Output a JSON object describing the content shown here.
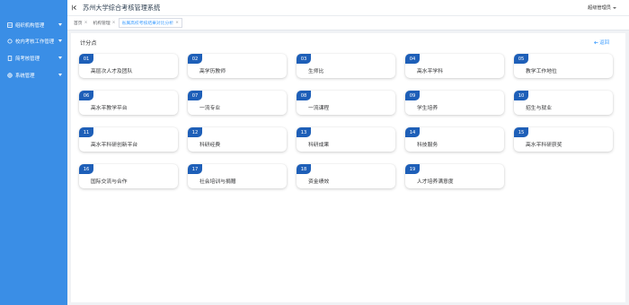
{
  "app": {
    "title": "苏州大学综合考核管理系统"
  },
  "header": {
    "user_label": "超级管理员"
  },
  "sidebar": {
    "items": [
      {
        "label": "组织机构管理",
        "icon": "org-icon"
      },
      {
        "label": "校内考核工作管理",
        "icon": "work-icon"
      },
      {
        "label": "简考核管理",
        "icon": "eval-icon"
      },
      {
        "label": "系统管理",
        "icon": "settings-icon"
      }
    ]
  },
  "tabs": [
    {
      "label": "首页",
      "active": false
    },
    {
      "label": "机构管理",
      "active": false
    },
    {
      "label": "省属高校考核结果对比分析",
      "active": true
    }
  ],
  "main": {
    "section_title": "计分点",
    "back_label": "返回",
    "cards": [
      {
        "num": "01",
        "label": "高层次人才及团队"
      },
      {
        "num": "02",
        "label": "高学历教师"
      },
      {
        "num": "03",
        "label": "生师比"
      },
      {
        "num": "04",
        "label": "高水平学科"
      },
      {
        "num": "05",
        "label": "教学工作地位"
      },
      {
        "num": "06",
        "label": "高水平教学平台"
      },
      {
        "num": "07",
        "label": "一流专业"
      },
      {
        "num": "08",
        "label": "一流课程"
      },
      {
        "num": "09",
        "label": "学生培养"
      },
      {
        "num": "10",
        "label": "招生与就业"
      },
      {
        "num": "11",
        "label": "高水平科研创新平台"
      },
      {
        "num": "12",
        "label": "科研经费"
      },
      {
        "num": "13",
        "label": "科研成果"
      },
      {
        "num": "14",
        "label": "科技服务"
      },
      {
        "num": "15",
        "label": "高水平科研获奖"
      },
      {
        "num": "16",
        "label": "国际交流与合作"
      },
      {
        "num": "17",
        "label": "社会培训与捐赠"
      },
      {
        "num": "18",
        "label": "资金绩效"
      },
      {
        "num": "19",
        "label": "人才培养满意度"
      }
    ]
  },
  "colors": {
    "sidebar": "#3a8ee6",
    "badge": "#1e5fb8",
    "accent": "#409eff"
  }
}
